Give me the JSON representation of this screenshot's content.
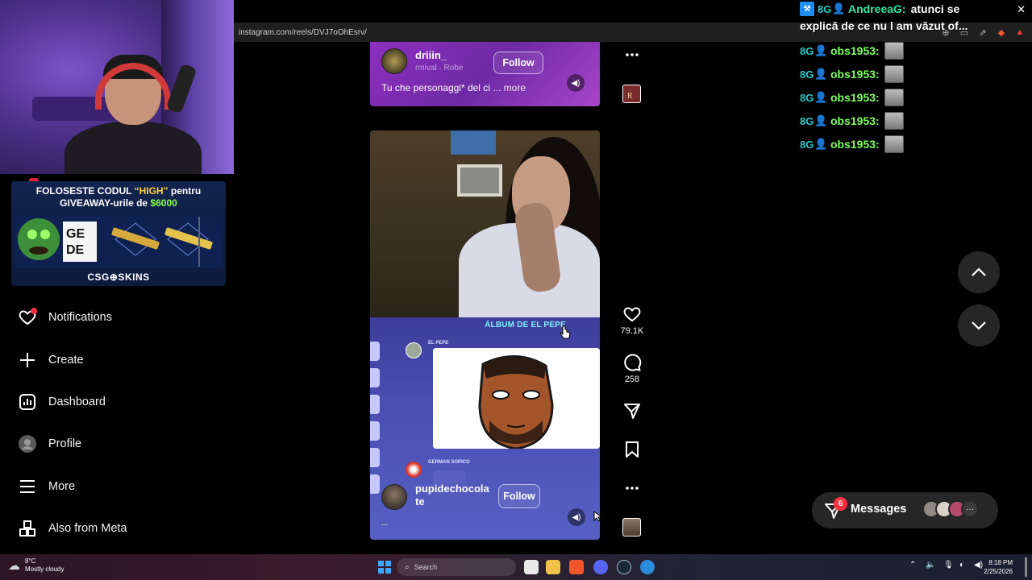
{
  "browser": {
    "url": "instagram.com/reels/DVJ7oOhEsrv/",
    "close_glyph": "✕"
  },
  "stream_overlay": {
    "promo": {
      "line1_pre": "FOLOSESTE CODUL ",
      "line1_highlight": "“HIGH”",
      "line1_post": " pentru",
      "line2_pre": "GIVEAWAY-urile de ",
      "line2_highlight": "$6000",
      "brand": "CSG⊕SKINS",
      "highlight_color": "#ffd23a",
      "money_color": "#8cff4d"
    },
    "chat": [
      {
        "user": "AndreeaG:",
        "message": "atunci se",
        "continuation": "explică de ce nu l am văzut of..."
      },
      {
        "user": "obs1953:"
      },
      {
        "user": "obs1953:"
      },
      {
        "user": "obs1953:"
      },
      {
        "user": "obs1953:"
      },
      {
        "user": "obs1953:"
      }
    ],
    "badge_text": "8G"
  },
  "sidebar": {
    "items": [
      {
        "label": "Notifications",
        "icon": "heart-icon"
      },
      {
        "label": "Create",
        "icon": "plus-icon"
      },
      {
        "label": "Dashboard",
        "icon": "dashboard-icon"
      },
      {
        "label": "Profile",
        "icon": "profile-avatar-icon"
      },
      {
        "label": "More",
        "icon": "menu-icon"
      },
      {
        "label": "Also from Meta",
        "icon": "meta-grid-icon"
      }
    ]
  },
  "reels": {
    "top_reel": {
      "username": "driiin_",
      "audio": "rmival · Robe",
      "follow_label": "Follow",
      "caption": "Tu che personaggi* del ci",
      "more_label": "... more"
    },
    "current_reel": {
      "overlay_title": "ÁLBUM DE EL PEPE",
      "chat_label_1": "EL PEPE",
      "chat_label_2": "GERMAN SOPICO",
      "username": "pupidechocolate",
      "follow_label": "Follow",
      "more_dots": "...",
      "likes": "79.1K",
      "comments": "258"
    }
  },
  "messages": {
    "label": "Messages",
    "unread": "6",
    "more_glyph": "···"
  },
  "taskbar": {
    "weather_temp": "8°C",
    "weather_desc": "Mostly cloudy",
    "search_placeholder": "Search",
    "time": "8:18 PM",
    "date": "2/25/2026"
  },
  "colors": {
    "accent_red": "#ff3040",
    "chat_name_green": "#7dff5c",
    "chat_name_teal": "#2ee8a6",
    "album_title": "#7ef2ff"
  }
}
